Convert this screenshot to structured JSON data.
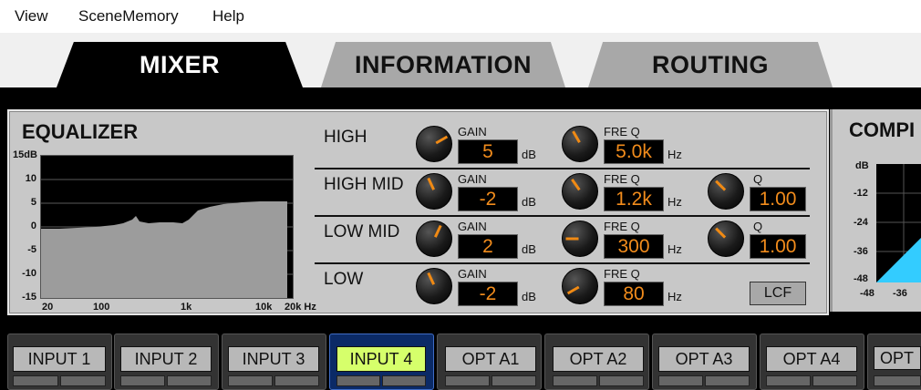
{
  "menu": {
    "items": [
      "View",
      "SceneMemory",
      "Help"
    ]
  },
  "tabs": {
    "items": [
      "MIXER",
      "INFORMATION",
      "ROUTING"
    ],
    "active": "MIXER"
  },
  "equalizer": {
    "title": "EQUALIZER",
    "y_ticks": [
      "15dB",
      "10",
      "5",
      "0",
      "-5",
      "-10",
      "-15"
    ],
    "x_ticks": [
      "20",
      "100",
      "1k",
      "10k",
      "20k Hz"
    ],
    "curve_color": "#9c9c9c",
    "bands": [
      {
        "label": "HIGH",
        "gain_label": "GAIN",
        "gain": "5",
        "gain_unit": "dB",
        "freq_label": "FRE Q",
        "freq": "5.0k",
        "freq_unit": "Hz"
      },
      {
        "label": "HIGH MID",
        "gain_label": "GAIN",
        "gain": "-2",
        "gain_unit": "dB",
        "freq_label": "FRE Q",
        "freq": "1.2k",
        "freq_unit": "Hz",
        "q_label": "Q",
        "q": "1.00"
      },
      {
        "label": "LOW MID",
        "gain_label": "GAIN",
        "gain": "2",
        "gain_unit": "dB",
        "freq_label": "FRE Q",
        "freq": "300",
        "freq_unit": "Hz",
        "q_label": "Q",
        "q": "1.00"
      },
      {
        "label": "LOW",
        "gain_label": "GAIN",
        "gain": "-2",
        "gain_unit": "dB",
        "freq_label": "FRE Q",
        "freq": "80",
        "freq_unit": "Hz"
      }
    ],
    "lcf_label": "LCF"
  },
  "compressor": {
    "title": "COMPI",
    "y_ticks": [
      "dB",
      "-12",
      "-24",
      "-36",
      "-48"
    ],
    "x_ticks": [
      "-48",
      "-36"
    ],
    "fill_color": "#33ccff"
  },
  "channels": {
    "items": [
      "INPUT 1",
      "INPUT 2",
      "INPUT 3",
      "INPUT 4",
      "OPT A1",
      "OPT A2",
      "OPT A3",
      "OPT A4",
      "OPT"
    ],
    "active": "INPUT 4"
  },
  "colors": {
    "value_text": "#f28c1c",
    "knob_indicator": "#f08a14",
    "active_channel": "#d6ff6b"
  }
}
